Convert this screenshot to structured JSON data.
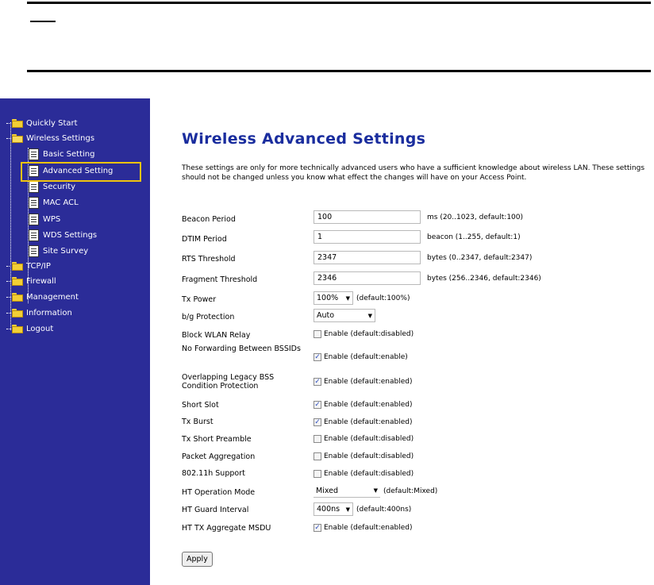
{
  "sidebar": {
    "items": [
      {
        "label": "Quickly Start",
        "type": "folder"
      },
      {
        "label": "Wireless Settings",
        "type": "folder-open"
      },
      {
        "label": "Basic Setting",
        "type": "page"
      },
      {
        "label": "Advanced Setting",
        "type": "page",
        "selected": true
      },
      {
        "label": "Security",
        "type": "page"
      },
      {
        "label": "MAC ACL",
        "type": "page"
      },
      {
        "label": "WPS",
        "type": "page"
      },
      {
        "label": "WDS Settings",
        "type": "page"
      },
      {
        "label": "Site Survey",
        "type": "page"
      },
      {
        "label": "TCP/IP",
        "type": "folder"
      },
      {
        "label": "Firewall",
        "type": "folder"
      },
      {
        "label": "Management",
        "type": "folder"
      },
      {
        "label": "Information",
        "type": "folder"
      },
      {
        "label": "Logout",
        "type": "folder"
      }
    ]
  },
  "main": {
    "title": "Wireless Advanced Settings",
    "description": "These settings are only for more technically advanced users who have a sufficient knowledge about wireless LAN. These settings should not be changed unless you know what effect the changes will have on your Access Point.",
    "fields": {
      "beacon": {
        "label": "Beacon Period",
        "value": "100",
        "hint": "ms (20..1023, default:100)"
      },
      "dtim": {
        "label": "DTIM Period",
        "value": "1",
        "hint": "beacon (1..255, default:1)"
      },
      "rts": {
        "label": "RTS Threshold",
        "value": "2347",
        "hint": "bytes (0..2347, default:2347)"
      },
      "frag": {
        "label": "Fragment Threshold",
        "value": "2346",
        "hint": "bytes (256..2346, default:2346)"
      },
      "txpower": {
        "label": "Tx Power",
        "value": "100%",
        "hint": "(default:100%)"
      },
      "bg": {
        "label": "b/g Protection",
        "value": "Auto"
      },
      "blockrelay": {
        "label": "Block WLAN Relay",
        "checked": false,
        "hint": "Enable (default:disabled)"
      },
      "noforward": {
        "label": "No Forwarding Between BSSIDs",
        "checked": true,
        "hint": "Enable (default:enable)"
      },
      "overlap": {
        "label": "Overlapping Legacy BSS Condition Protection",
        "checked": true,
        "hint": "Enable (default:enabled)"
      },
      "shortslot": {
        "label": "Short Slot",
        "checked": true,
        "hint": "Enable (default:enabled)"
      },
      "txburst": {
        "label": "Tx Burst",
        "checked": true,
        "hint": "Enable (default:enabled)"
      },
      "preamble": {
        "label": "Tx Short Preamble",
        "checked": false,
        "hint": "Enable (default:disabled)"
      },
      "aggregation": {
        "label": "Packet Aggregation",
        "checked": false,
        "hint": "Enable (default:disabled)"
      },
      "dot11h": {
        "label": "802.11h Support",
        "checked": false,
        "hint": "Enable (default:disabled)"
      },
      "htmode": {
        "label": "HT Operation Mode",
        "value": "Mixed",
        "hint": "(default:Mixed)"
      },
      "htguard": {
        "label": "HT Guard Interval",
        "value": "400ns",
        "hint": "(default:400ns)"
      },
      "htmsdu": {
        "label": "HT TX Aggregate MSDU",
        "checked": true,
        "hint": "Enable (default:enabled)"
      }
    },
    "apply_label": "Apply"
  },
  "colors": {
    "sidebar_bg": "#2b2c98",
    "title": "#1a2d9e",
    "highlight": "#f1c40f"
  }
}
